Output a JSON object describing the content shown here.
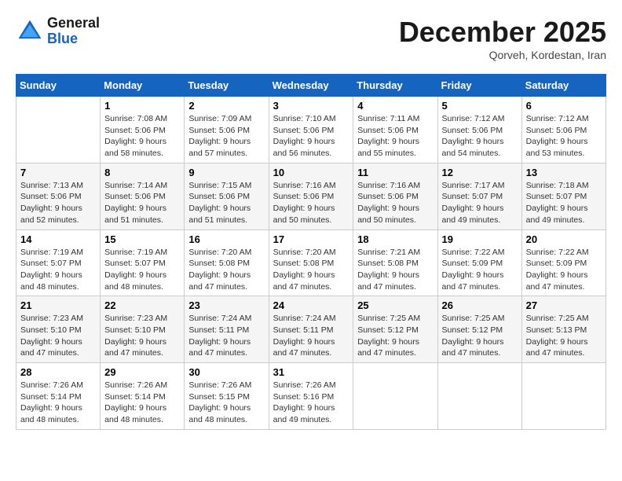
{
  "header": {
    "logo_general": "General",
    "logo_blue": "Blue",
    "month_title": "December 2025",
    "location": "Qorveh, Kordestan, Iran"
  },
  "weekdays": [
    "Sunday",
    "Monday",
    "Tuesday",
    "Wednesday",
    "Thursday",
    "Friday",
    "Saturday"
  ],
  "weeks": [
    [
      {
        "day": "",
        "info": ""
      },
      {
        "day": "1",
        "info": "Sunrise: 7:08 AM\nSunset: 5:06 PM\nDaylight: 9 hours\nand 58 minutes."
      },
      {
        "day": "2",
        "info": "Sunrise: 7:09 AM\nSunset: 5:06 PM\nDaylight: 9 hours\nand 57 minutes."
      },
      {
        "day": "3",
        "info": "Sunrise: 7:10 AM\nSunset: 5:06 PM\nDaylight: 9 hours\nand 56 minutes."
      },
      {
        "day": "4",
        "info": "Sunrise: 7:11 AM\nSunset: 5:06 PM\nDaylight: 9 hours\nand 55 minutes."
      },
      {
        "day": "5",
        "info": "Sunrise: 7:12 AM\nSunset: 5:06 PM\nDaylight: 9 hours\nand 54 minutes."
      },
      {
        "day": "6",
        "info": "Sunrise: 7:12 AM\nSunset: 5:06 PM\nDaylight: 9 hours\nand 53 minutes."
      }
    ],
    [
      {
        "day": "7",
        "info": "Sunrise: 7:13 AM\nSunset: 5:06 PM\nDaylight: 9 hours\nand 52 minutes."
      },
      {
        "day": "8",
        "info": "Sunrise: 7:14 AM\nSunset: 5:06 PM\nDaylight: 9 hours\nand 51 minutes."
      },
      {
        "day": "9",
        "info": "Sunrise: 7:15 AM\nSunset: 5:06 PM\nDaylight: 9 hours\nand 51 minutes."
      },
      {
        "day": "10",
        "info": "Sunrise: 7:16 AM\nSunset: 5:06 PM\nDaylight: 9 hours\nand 50 minutes."
      },
      {
        "day": "11",
        "info": "Sunrise: 7:16 AM\nSunset: 5:06 PM\nDaylight: 9 hours\nand 50 minutes."
      },
      {
        "day": "12",
        "info": "Sunrise: 7:17 AM\nSunset: 5:07 PM\nDaylight: 9 hours\nand 49 minutes."
      },
      {
        "day": "13",
        "info": "Sunrise: 7:18 AM\nSunset: 5:07 PM\nDaylight: 9 hours\nand 49 minutes."
      }
    ],
    [
      {
        "day": "14",
        "info": "Sunrise: 7:19 AM\nSunset: 5:07 PM\nDaylight: 9 hours\nand 48 minutes."
      },
      {
        "day": "15",
        "info": "Sunrise: 7:19 AM\nSunset: 5:07 PM\nDaylight: 9 hours\nand 48 minutes."
      },
      {
        "day": "16",
        "info": "Sunrise: 7:20 AM\nSunset: 5:08 PM\nDaylight: 9 hours\nand 47 minutes."
      },
      {
        "day": "17",
        "info": "Sunrise: 7:20 AM\nSunset: 5:08 PM\nDaylight: 9 hours\nand 47 minutes."
      },
      {
        "day": "18",
        "info": "Sunrise: 7:21 AM\nSunset: 5:08 PM\nDaylight: 9 hours\nand 47 minutes."
      },
      {
        "day": "19",
        "info": "Sunrise: 7:22 AM\nSunset: 5:09 PM\nDaylight: 9 hours\nand 47 minutes."
      },
      {
        "day": "20",
        "info": "Sunrise: 7:22 AM\nSunset: 5:09 PM\nDaylight: 9 hours\nand 47 minutes."
      }
    ],
    [
      {
        "day": "21",
        "info": "Sunrise: 7:23 AM\nSunset: 5:10 PM\nDaylight: 9 hours\nand 47 minutes."
      },
      {
        "day": "22",
        "info": "Sunrise: 7:23 AM\nSunset: 5:10 PM\nDaylight: 9 hours\nand 47 minutes."
      },
      {
        "day": "23",
        "info": "Sunrise: 7:24 AM\nSunset: 5:11 PM\nDaylight: 9 hours\nand 47 minutes."
      },
      {
        "day": "24",
        "info": "Sunrise: 7:24 AM\nSunset: 5:11 PM\nDaylight: 9 hours\nand 47 minutes."
      },
      {
        "day": "25",
        "info": "Sunrise: 7:25 AM\nSunset: 5:12 PM\nDaylight: 9 hours\nand 47 minutes."
      },
      {
        "day": "26",
        "info": "Sunrise: 7:25 AM\nSunset: 5:12 PM\nDaylight: 9 hours\nand 47 minutes."
      },
      {
        "day": "27",
        "info": "Sunrise: 7:25 AM\nSunset: 5:13 PM\nDaylight: 9 hours\nand 47 minutes."
      }
    ],
    [
      {
        "day": "28",
        "info": "Sunrise: 7:26 AM\nSunset: 5:14 PM\nDaylight: 9 hours\nand 48 minutes."
      },
      {
        "day": "29",
        "info": "Sunrise: 7:26 AM\nSunset: 5:14 PM\nDaylight: 9 hours\nand 48 minutes."
      },
      {
        "day": "30",
        "info": "Sunrise: 7:26 AM\nSunset: 5:15 PM\nDaylight: 9 hours\nand 48 minutes."
      },
      {
        "day": "31",
        "info": "Sunrise: 7:26 AM\nSunset: 5:16 PM\nDaylight: 9 hours\nand 49 minutes."
      },
      {
        "day": "",
        "info": ""
      },
      {
        "day": "",
        "info": ""
      },
      {
        "day": "",
        "info": ""
      }
    ]
  ]
}
